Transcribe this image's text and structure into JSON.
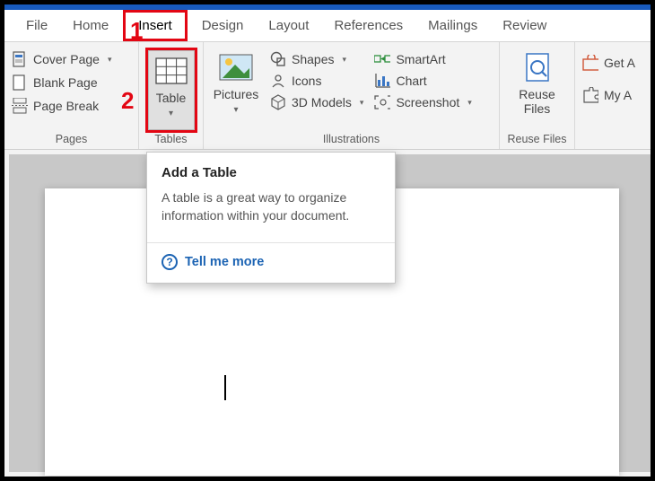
{
  "tabs": {
    "file": "File",
    "home": "Home",
    "insert": "Insert",
    "design": "Design",
    "layout": "Layout",
    "references": "References",
    "mailings": "Mailings",
    "review": "Review"
  },
  "pages_group": {
    "cover_page": "Cover Page",
    "blank_page": "Blank Page",
    "page_break": "Page Break",
    "label": "Pages"
  },
  "tables_group": {
    "table": "Table",
    "label": "Tables"
  },
  "illustrations_group": {
    "pictures": "Pictures",
    "shapes": "Shapes",
    "icons": "Icons",
    "models": "3D Models",
    "smartart": "SmartArt",
    "chart": "Chart",
    "screenshot": "Screenshot",
    "label": "Illustrations"
  },
  "reuse_group": {
    "reuse": "Reuse\nFiles",
    "label": "Reuse Files"
  },
  "truncated": {
    "get": "Get A",
    "my": "My A"
  },
  "tooltip": {
    "title": "Add a Table",
    "body": "A table is a great way to organize information within your document.",
    "link": "Tell me more"
  },
  "annotations": {
    "one": "1",
    "two": "2"
  }
}
